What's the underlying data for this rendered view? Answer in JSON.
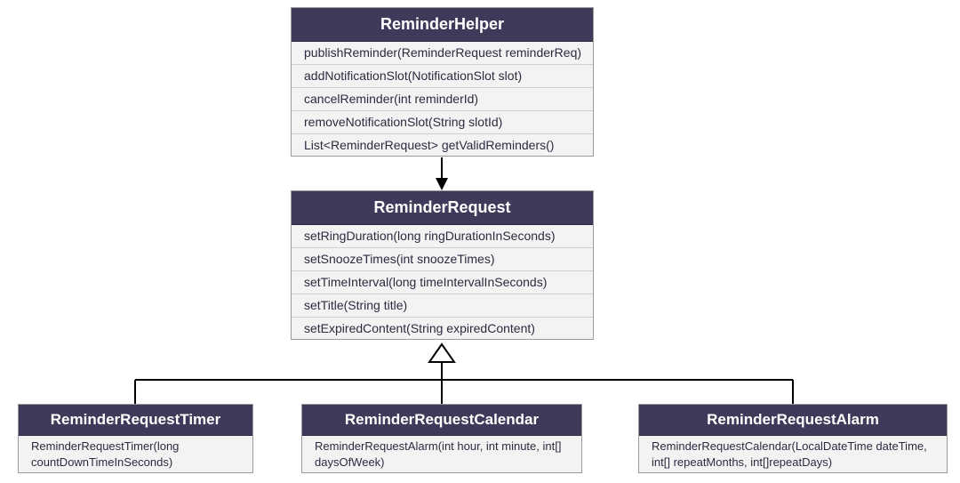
{
  "colors": {
    "header_bg": "#403a5a",
    "header_text": "#ffffff",
    "body_bg": "#f3f3f3",
    "border": "#9a9a9a",
    "row_divider": "#cfcfcf",
    "text": "#2d2a3f"
  },
  "classes": {
    "helper": {
      "name": "ReminderHelper",
      "methods": [
        "publishReminder(ReminderRequest reminderReq)",
        "addNotificationSlot(NotificationSlot slot)",
        "cancelReminder(int reminderId)",
        "removeNotificationSlot(String slotId)",
        "List<ReminderRequest> getValidReminders()"
      ]
    },
    "request": {
      "name": "ReminderRequest",
      "methods": [
        "setRingDuration(long ringDurationInSeconds)",
        "setSnoozeTimes(int snoozeTimes)",
        "setTimeInterval(long timeIntervalInSeconds)",
        "setTitle(String title)",
        "setExpiredContent(String expiredContent)"
      ]
    },
    "timer": {
      "name": "ReminderRequestTimer",
      "methods": [
        "ReminderRequestTimer(long countDownTimeInSeconds)"
      ]
    },
    "calendar": {
      "name": "ReminderRequestCalendar",
      "methods": [
        "ReminderRequestAlarm(int hour, int minute, int[] daysOfWeek)"
      ]
    },
    "alarm": {
      "name": "ReminderRequestAlarm",
      "methods": [
        "ReminderRequestCalendar(LocalDateTime dateTime, int[] repeatMonths, int[]repeatDays)"
      ]
    }
  },
  "relationships": [
    {
      "from": "ReminderHelper",
      "to": "ReminderRequest",
      "kind": "association-arrow"
    },
    {
      "from": "ReminderRequestTimer",
      "to": "ReminderRequest",
      "kind": "generalization"
    },
    {
      "from": "ReminderRequestCalendar",
      "to": "ReminderRequest",
      "kind": "generalization"
    },
    {
      "from": "ReminderRequestAlarm",
      "to": "ReminderRequest",
      "kind": "generalization"
    }
  ],
  "chart_data": {
    "type": "table",
    "description": "UML class diagram: ReminderHelper associates to ReminderRequest; ReminderRequestTimer, ReminderRequestCalendar, ReminderRequestAlarm each generalize (inherit from) ReminderRequest.",
    "nodes": [
      "ReminderHelper",
      "ReminderRequest",
      "ReminderRequestTimer",
      "ReminderRequestCalendar",
      "ReminderRequestAlarm"
    ],
    "edges": [
      [
        "ReminderHelper",
        "ReminderRequest",
        "uses"
      ],
      [
        "ReminderRequestTimer",
        "ReminderRequest",
        "inherits"
      ],
      [
        "ReminderRequestCalendar",
        "ReminderRequest",
        "inherits"
      ],
      [
        "ReminderRequestAlarm",
        "ReminderRequest",
        "inherits"
      ]
    ]
  }
}
